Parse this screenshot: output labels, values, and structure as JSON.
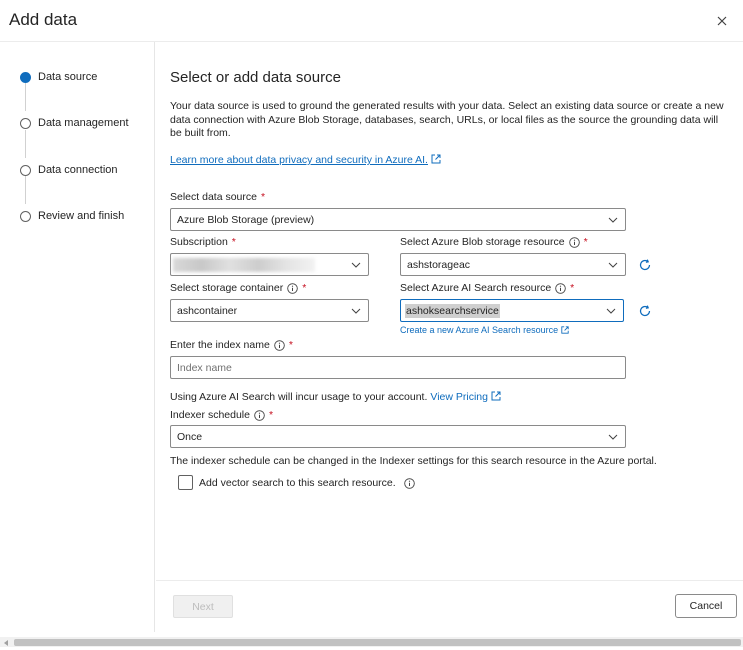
{
  "dialog": {
    "title": "Add data",
    "close_icon": "close-icon"
  },
  "stepper": {
    "steps": [
      {
        "label": "Data source",
        "state": "active"
      },
      {
        "label": "Data management",
        "state": "inactive"
      },
      {
        "label": "Data connection",
        "state": "inactive"
      },
      {
        "label": "Review and finish",
        "state": "inactive"
      }
    ]
  },
  "main": {
    "title": "Select or add data source",
    "description": "Your data source is used to ground the generated results with your data. Select an existing data source or create a new data connection with Azure Blob Storage, databases, search, URLs, or local files as the source the grounding data will be built from.",
    "learn_more_link": "Learn more about data privacy and security in Azure AI."
  },
  "form": {
    "data_source": {
      "label": "Select data source",
      "required_mark": "*",
      "value": "Azure Blob Storage (preview)"
    },
    "subscription": {
      "label": "Subscription",
      "required_mark": "*",
      "value_redacted": true
    },
    "blob_resource": {
      "label": "Select Azure Blob storage resource",
      "required_mark": "*",
      "value": "ashstorageac"
    },
    "storage_container": {
      "label": "Select storage container",
      "required_mark": "*",
      "value": "ashcontainer"
    },
    "search_resource": {
      "label": "Select Azure AI Search resource",
      "required_mark": "*",
      "value": "ashoksearchservice",
      "create_link": "Create a new Azure AI Search resource"
    },
    "index_name": {
      "label": "Enter the index name",
      "required_mark": "*",
      "placeholder": "Index name"
    },
    "usage_note": "Using Azure AI Search will incur usage to your account.",
    "pricing_link": "View Pricing",
    "indexer_schedule": {
      "label": "Indexer schedule",
      "required_mark": "*",
      "value": "Once"
    },
    "indexer_note": "The indexer schedule can be changed in the Indexer settings for this search resource in the Azure portal.",
    "vector_search": {
      "label": "Add vector search to this search resource.",
      "checked": false
    }
  },
  "footer": {
    "next_label": "Next",
    "next_disabled": true,
    "cancel_label": "Cancel"
  },
  "colors": {
    "accent": "#0f6cbd",
    "required": "#c50f1f",
    "text": "#242424"
  }
}
